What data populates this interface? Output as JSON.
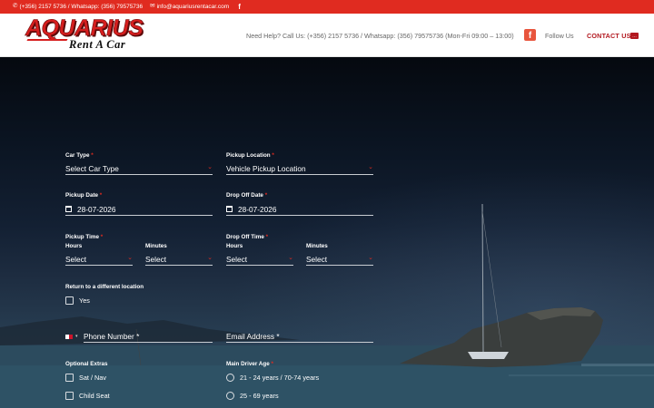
{
  "topbar": {
    "phone": "(+356) 2157 5736 / Whatsapp: (356) 79575736",
    "email": "info@aquariusrentacar.com",
    "facebook_glyph": "f",
    "phone_icon": "phone-icon",
    "email_icon": "envelope-icon",
    "bg_color": "#e02b20"
  },
  "header": {
    "logo_main": "AQUARIUS",
    "logo_sub": "Rent  A Car",
    "help_text": "Need Help? Call Us: (+356) 2157 5736 / Whatsapp: (356) 79575736 (Mon-Fri 09:00 – 13:00)",
    "facebook_glyph": "f",
    "follow_text": "Follow Us",
    "contact_label": "CONTACT US",
    "contact_color": "#b2181f"
  },
  "form": {
    "car_type": {
      "label": "Car Type",
      "value": "Select Car Type"
    },
    "pickup_location": {
      "label": "Pickup Location",
      "value": "Vehicle Pickup Location"
    },
    "pickup_date": {
      "label": "Pickup Date",
      "value": "28-07-2026"
    },
    "dropoff_date": {
      "label": "Drop Off Date",
      "value": "28-07-2026"
    },
    "pickup_time": {
      "label": "Pickup Time",
      "hours_label": "Hours",
      "minutes_label": "Minutes",
      "hours_value": "Select",
      "minutes_value": "Select"
    },
    "dropoff_time": {
      "label": "Drop Off Time",
      "hours_label": "Hours",
      "minutes_label": "Minutes",
      "hours_value": "Select",
      "minutes_value": "Select"
    },
    "return_location": {
      "label": "Return to a different location",
      "option": "Yes",
      "checked": false
    },
    "phone": {
      "placeholder": "Phone Number *",
      "country": "MT"
    },
    "email": {
      "placeholder": "Email Address *"
    },
    "optional_extras": {
      "label": "Optional Extras",
      "options": [
        "Sat / Nav",
        "Child Seat"
      ]
    },
    "driver_age": {
      "label": "Main Driver Age",
      "options": [
        "21 - 24 years / 70-74 years",
        "25 - 69 years"
      ]
    },
    "required_mark": "*",
    "accent_color": "#e02b20"
  }
}
